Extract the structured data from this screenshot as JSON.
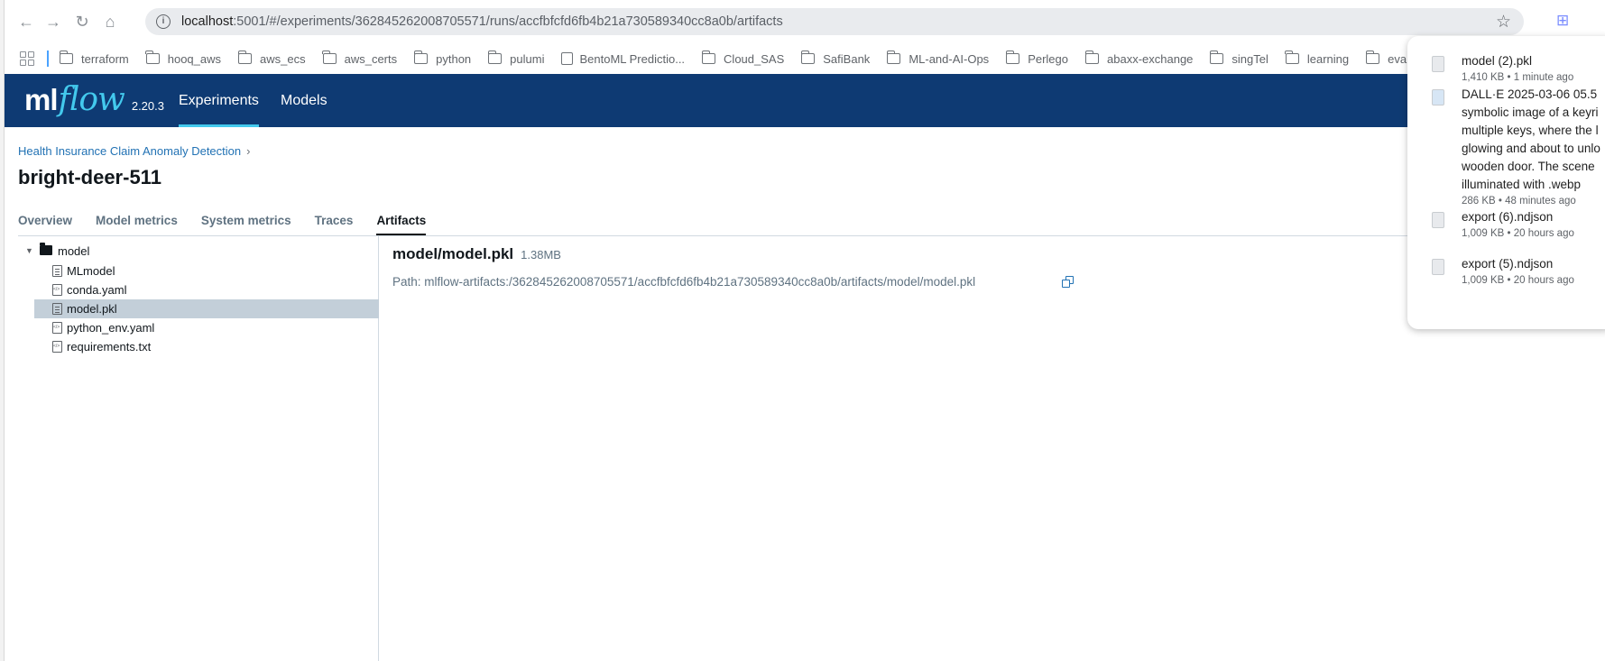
{
  "browser": {
    "url_host": "localhost",
    "url_rest": ":5001/#/experiments/362845262008705571/runs/accfbfcfd6fb4b21a730589340cc8a0b/artifacts",
    "bookmarks": [
      "terraform",
      "hooq_aws",
      "aws_ecs",
      "aws_certs",
      "python",
      "pulumi",
      "BentoML Predictio...",
      "Cloud_SAS",
      "SafiBank",
      "ML-and-AI-Ops",
      "Perlego",
      "abaxx-exchange",
      "singTel",
      "learning",
      "evantek"
    ]
  },
  "mlflow": {
    "logo_ml": "ml",
    "logo_flow": "flow",
    "version": "2.20.3",
    "nav": [
      "Experiments",
      "Models"
    ]
  },
  "page": {
    "breadcrumb": "Health Insurance Claim Anomaly Detection",
    "breadcrumb_chevron": "›",
    "run_name": "bright-deer-511",
    "tabs": [
      "Overview",
      "Model metrics",
      "System metrics",
      "Traces",
      "Artifacts"
    ]
  },
  "tree": {
    "folder": "model",
    "files": [
      "MLmodel",
      "conda.yaml",
      "model.pkl",
      "python_env.yaml",
      "requirements.txt"
    ]
  },
  "artifact": {
    "title": "model/model.pkl",
    "size": "1.38MB",
    "path": "Path: mlflow-artifacts:/362845262008705571/accfbfcfd6fb4b21a730589340cc8a0b/artifacts/model/model.pkl"
  },
  "downloads": [
    {
      "lines": [
        "model (2).pkl"
      ],
      "meta": "1,410 KB • 1 minute ago"
    },
    {
      "lines": [
        "DALL·E 2025-03-06 05.5",
        "symbolic image of a keyri",
        "multiple keys, where the l",
        "glowing and about to unlo",
        "wooden door. The scene",
        "illuminated with .webp"
      ],
      "meta": "286 KB • 48 minutes ago"
    },
    {
      "lines": [
        "export (6).ndjson"
      ],
      "meta": "1,009 KB • 20 hours ago"
    },
    {
      "lines": [
        "export (5).ndjson"
      ],
      "meta": "1,009 KB • 20 hours ago"
    }
  ]
}
